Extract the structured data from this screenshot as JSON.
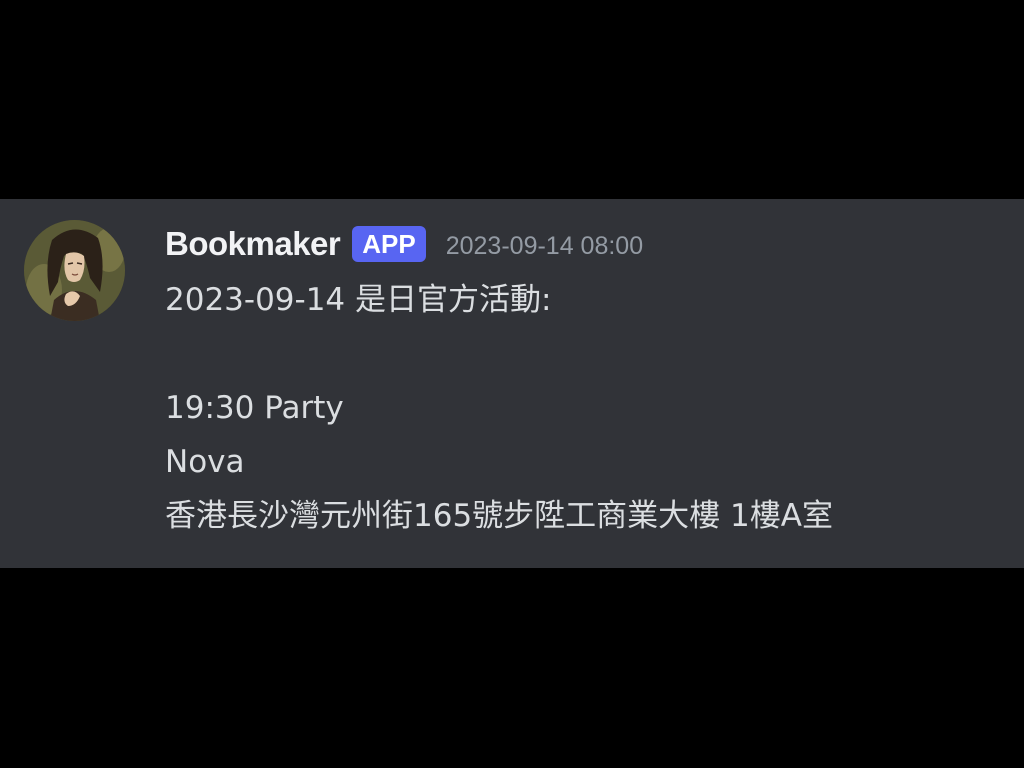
{
  "message": {
    "author": "Bookmaker",
    "badge": "APP",
    "timestamp": "2023-09-14 08:00",
    "lines": [
      "2023-09-14 是日官方活動:",
      "",
      "19:30 Party",
      "Nova",
      "香港長沙灣元州街165號步陞工商業大樓 1樓A室"
    ]
  },
  "colors": {
    "background": "#000000",
    "message_bg": "#313338",
    "badge_bg": "#5865f2",
    "username": "#f2f3f5",
    "timestamp": "#949ba4",
    "body_text": "#dbdee1"
  }
}
